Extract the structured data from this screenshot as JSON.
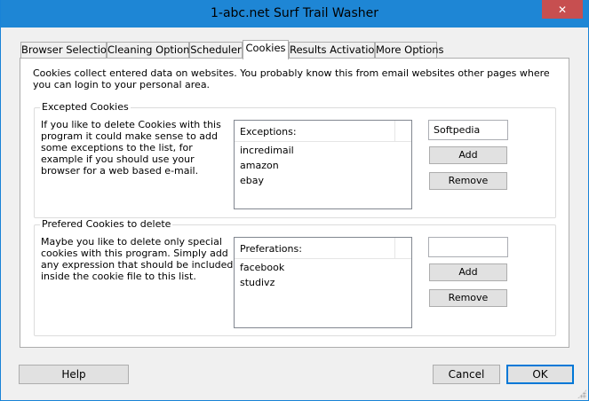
{
  "window": {
    "title": "1-abc.net Surf Trail Washer",
    "close_glyph": "✕"
  },
  "tabs": [
    {
      "label": "Browser Selection"
    },
    {
      "label": "Cleaning Options"
    },
    {
      "label": "Scheduler"
    },
    {
      "label": "Cookies",
      "active": true
    },
    {
      "label": "Results Activation"
    },
    {
      "label": "More Options"
    }
  ],
  "intro": "Cookies collect entered data on websites. You probably know this from email websites other pages where you can login to your personal area.",
  "excepted": {
    "title": "Excepted Cookies",
    "description": "If you like to delete Cookies with this program it could make sense to add some exceptions to the list, for example if you should use your browser for a web based e-mail.",
    "list_header": "Exceptions:",
    "items": [
      "incredimail",
      "amazon",
      "ebay"
    ],
    "input_value": "Softpedia",
    "add_label": "Add",
    "remove_label": "Remove"
  },
  "preferred": {
    "title": "Prefered Cookies to delete",
    "description": "Maybe you like to delete only special cookies with this program. Simply add any expression that should be included inside the cookie file to this list.",
    "list_header": "Preferations:",
    "items": [
      "facebook",
      "studivz"
    ],
    "input_value": "",
    "add_label": "Add",
    "remove_label": "Remove"
  },
  "footer": {
    "help_label": "Help",
    "cancel_label": "Cancel",
    "ok_label": "OK"
  }
}
